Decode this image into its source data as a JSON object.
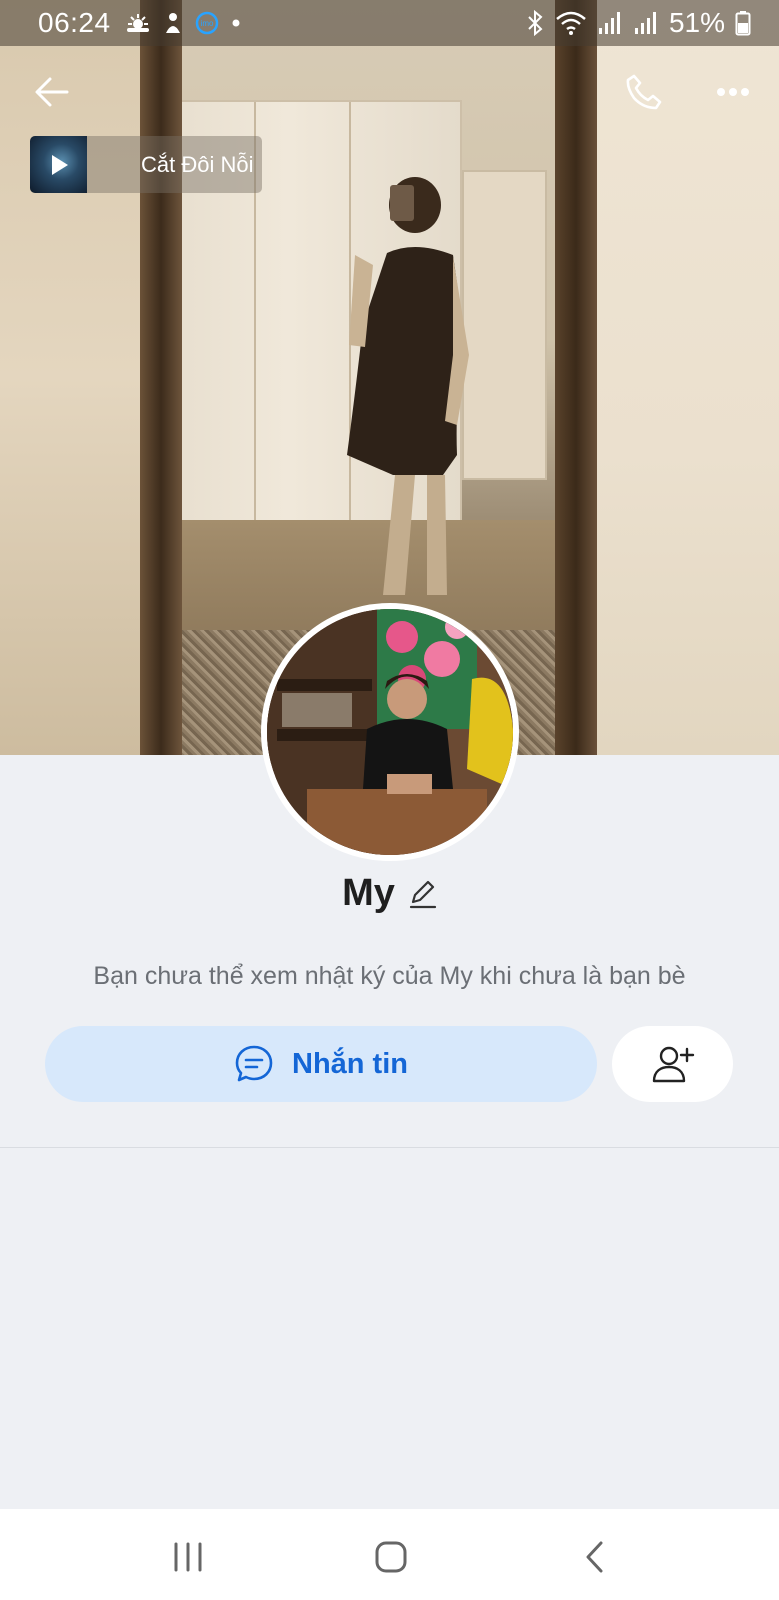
{
  "status_bar": {
    "time": "06:24",
    "left_icons": [
      "weather-icon",
      "notification-icon",
      "imo-icon",
      "dot-icon"
    ],
    "right_icons": [
      "bluetooth-icon",
      "wifi-icon",
      "signal-icon",
      "signal-icon",
      "battery-icon"
    ],
    "battery": "51%"
  },
  "header": {
    "back_icon": "arrow-left-icon",
    "call_icon": "phone-icon",
    "more_icon": "more-dots-icon"
  },
  "music": {
    "title": "Cắt Đôi Nỗi Sầu"
  },
  "profile": {
    "name": "My",
    "edit_icon": "pencil-icon",
    "notice": "Bạn chưa thể xem nhật ký của My khi chưa là bạn bè"
  },
  "actions": {
    "message_label": "Nhắn tin",
    "message_icon": "chat-bubble-icon",
    "add_friend_icon": "add-user-icon"
  },
  "colors": {
    "accent": "#1466d6",
    "message_bg": "#d7e8fb",
    "page_bg": "#eef0f4"
  },
  "nav": {
    "recent_icon": "recent-apps-icon",
    "home_icon": "home-icon",
    "back_icon": "back-icon"
  }
}
